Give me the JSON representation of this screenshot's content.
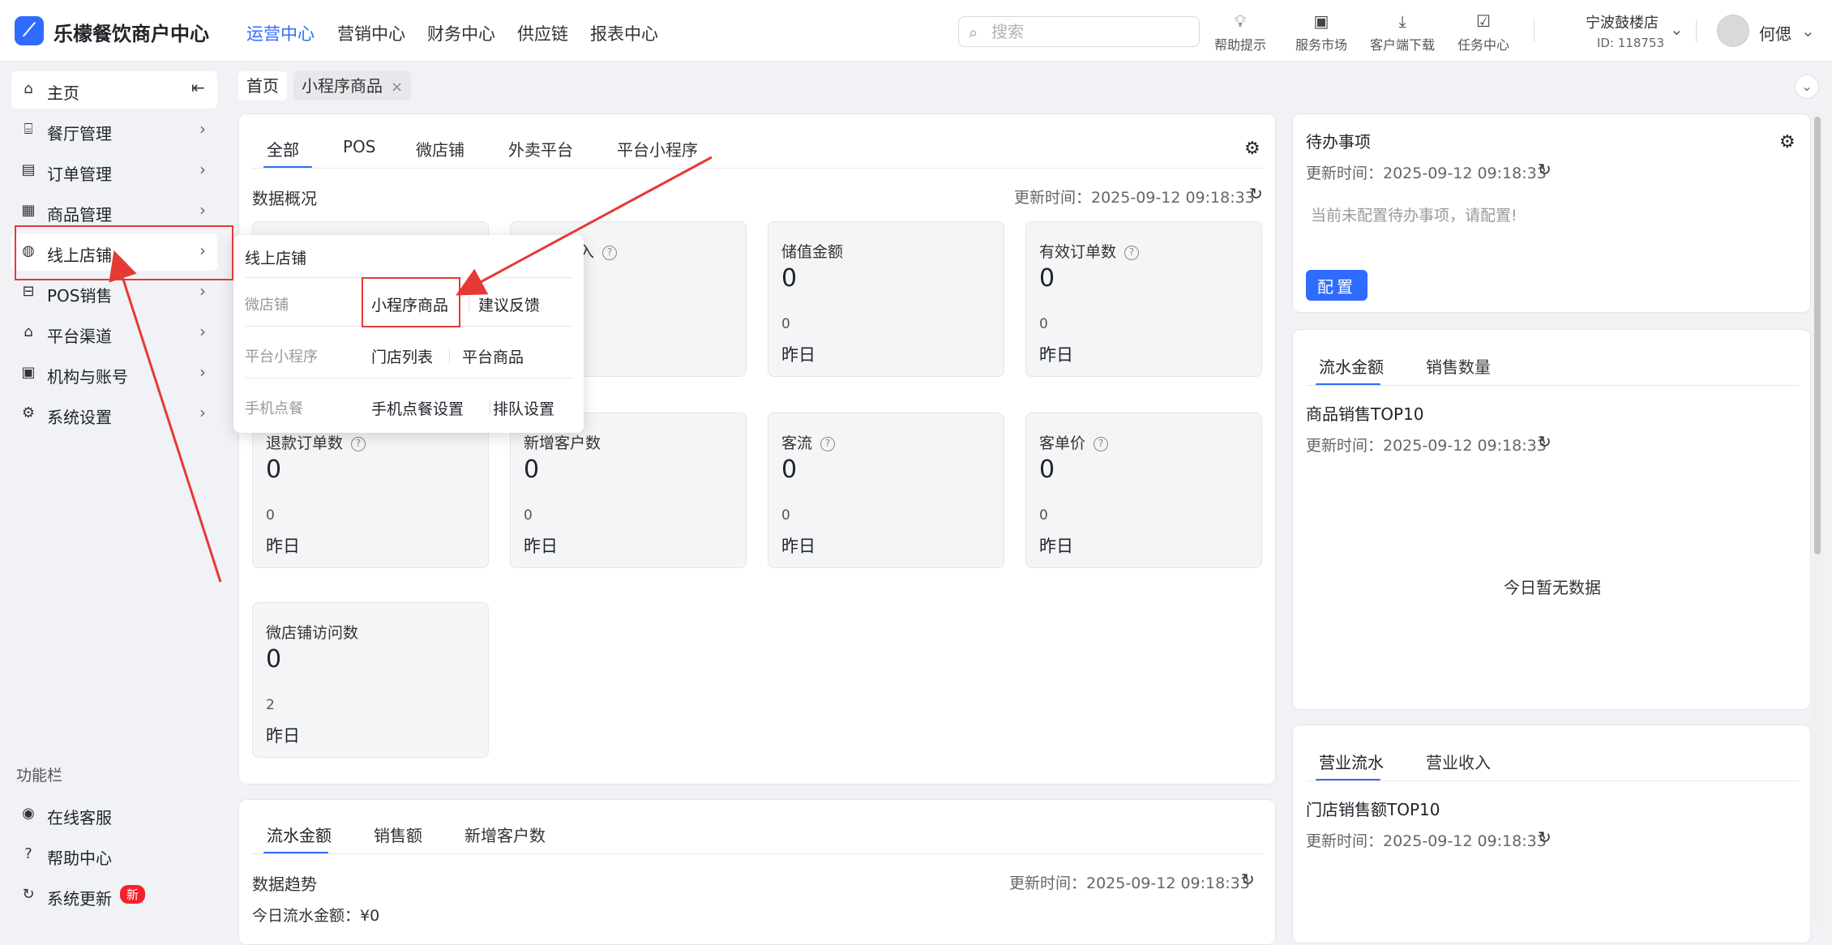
{
  "brand": {
    "name": "乐檬餐饮商户中心"
  },
  "top_nav": [
    {
      "label": "运营中心",
      "active": true
    },
    {
      "label": "营销中心"
    },
    {
      "label": "财务中心"
    },
    {
      "label": "供应链"
    },
    {
      "label": "报表中心"
    }
  ],
  "search": {
    "placeholder": "搜索"
  },
  "tools": [
    {
      "label": "帮助提示",
      "icon": "bulb-icon"
    },
    {
      "label": "服务市场",
      "icon": "market-icon"
    },
    {
      "label": "客户端下载",
      "icon": "download-icon"
    },
    {
      "label": "任务中心",
      "icon": "task-icon"
    }
  ],
  "store": {
    "name": "宁波鼓楼店",
    "id": "ID: 118753"
  },
  "user": {
    "name": "何偲"
  },
  "sidebar": {
    "items": [
      {
        "label": "主页",
        "icon": "home-icon"
      },
      {
        "label": "餐厅管理",
        "icon": "restaurant-icon"
      },
      {
        "label": "订单管理",
        "icon": "order-icon"
      },
      {
        "label": "商品管理",
        "icon": "goods-icon"
      },
      {
        "label": "线上店铺",
        "icon": "globe-icon"
      },
      {
        "label": "POS销售",
        "icon": "pos-icon"
      },
      {
        "label": "平台渠道",
        "icon": "bank-icon"
      },
      {
        "label": "机构与账号",
        "icon": "account-icon"
      },
      {
        "label": "系统设置",
        "icon": "gear-icon"
      }
    ],
    "function_title": "功能栏",
    "functions": [
      {
        "label": "在线客服",
        "icon": "service-icon"
      },
      {
        "label": "帮助中心",
        "icon": "help-icon"
      },
      {
        "label": "系统更新",
        "icon": "update-icon",
        "badge": "新"
      }
    ]
  },
  "page_tabs": {
    "home": "首页",
    "current": "小程序商品",
    "close": "×"
  },
  "main": {
    "tabs": [
      "全部",
      "POS",
      "微店铺",
      "外卖平台",
      "平台小程序"
    ],
    "section_title": "数据概况",
    "update_time": "更新时间：2025-09-12 09:18:33",
    "stats": [
      {
        "label": "",
        "value": "",
        "sub": "",
        "day": ""
      },
      {
        "label": "入",
        "help": true,
        "value": "",
        "sub": "",
        "day": ""
      },
      {
        "label": "储值金额",
        "value": "0",
        "sub": "0",
        "day": "昨日"
      },
      {
        "label": "有效订单数",
        "help": true,
        "value": "0",
        "sub": "0",
        "day": "昨日"
      },
      {
        "label": "退款订单数",
        "help": true,
        "value": "0",
        "sub": "0",
        "day": "昨日"
      },
      {
        "label": "新增客户数",
        "value": "0",
        "sub": "0",
        "day": "昨日"
      },
      {
        "label": "客流",
        "help": true,
        "value": "0",
        "sub": "0",
        "day": "昨日"
      },
      {
        "label": "客单价",
        "help": true,
        "value": "0",
        "sub": "0",
        "day": "昨日"
      },
      {
        "label": "微店铺访问数",
        "value": "0",
        "sub": "2",
        "day": "昨日"
      }
    ]
  },
  "trend": {
    "tabs": [
      "流水金额",
      "销售额",
      "新增客户数"
    ],
    "title": "数据趋势",
    "update_time": "更新时间：2025-09-12 09:18:33",
    "today": "今日流水金额：¥0"
  },
  "todo": {
    "title": "待办事项",
    "update_time": "更新时间：2025-09-12 09:18:33",
    "empty": "当前未配置待办事项，请配置!",
    "button": "配置"
  },
  "top10": {
    "tabs": [
      "流水金额",
      "销售数量"
    ],
    "title": "商品销售TOP10",
    "update_time": "更新时间：2025-09-12 09:18:33",
    "empty": "今日暂无数据"
  },
  "store_top10": {
    "tabs": [
      "营业流水",
      "营业收入"
    ],
    "title": "门店销售额TOP10",
    "update_time": "更新时间：2025-09-12 09:18:33"
  },
  "popup": {
    "title": "线上店铺",
    "rows": [
      {
        "label": "微店铺",
        "links": [
          "小程序商品",
          "建议反馈"
        ]
      },
      {
        "label": "平台小程序",
        "links": [
          "门店列表",
          "平台商品"
        ]
      },
      {
        "label": "手机点餐",
        "links": [
          "手机点餐设置",
          "排队设置"
        ]
      }
    ]
  },
  "colors": {
    "accent": "#2f6bff",
    "annotation": "#e53935",
    "badge": "#f5222d"
  }
}
